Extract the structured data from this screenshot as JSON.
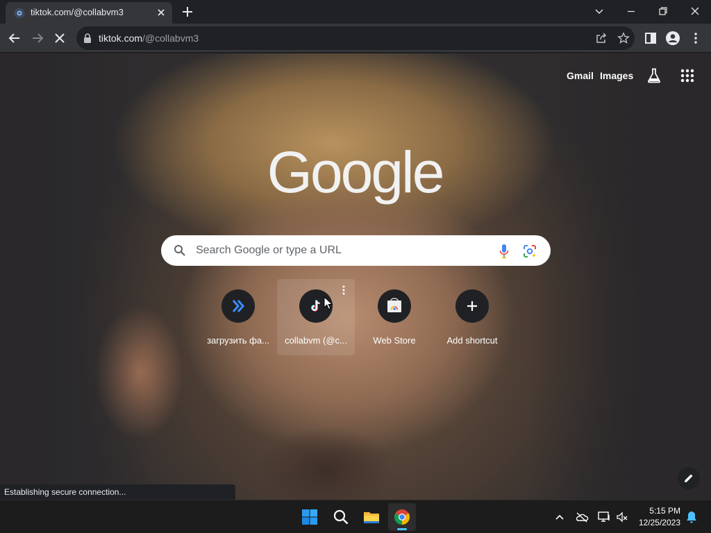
{
  "browser": {
    "tab": {
      "title": "tiktok.com/@collabvm3",
      "favicon": "tiktok-favicon-icon",
      "close": "close-icon"
    },
    "new_tab": "plus-icon",
    "window_controls": [
      "chevron-down-icon",
      "minimize-icon",
      "restore-icon",
      "close-icon"
    ]
  },
  "toolbar": {
    "buttons": [
      "back-arrow-icon",
      "forward-arrow-icon",
      "stop-loading-icon"
    ],
    "url_host": "tiktok.com",
    "url_path": "/@collabvm3",
    "omnibox_icons": [
      "share-icon",
      "star-icon"
    ],
    "right_icons": [
      "side-panel-icon",
      "profile-icon",
      "menu-dots-icon"
    ]
  },
  "ntp": {
    "top_links": {
      "gmail": "Gmail",
      "images": "Images"
    },
    "logo": "Google",
    "search": {
      "placeholder": "Search Google or type a URL"
    },
    "shortcuts": [
      {
        "label": "загрузить фа...",
        "icon": "double-chevron-icon",
        "hovered": false
      },
      {
        "label": "collabvm (@c...",
        "icon": "tiktok-icon",
        "hovered": true
      },
      {
        "label": "Web Store",
        "icon": "webstore-icon",
        "hovered": false
      },
      {
        "label": "Add shortcut",
        "icon": "plus-icon",
        "hovered": false
      }
    ],
    "customize": "pencil-icon"
  },
  "status_bubble": "Establishing secure connection...",
  "taskbar": {
    "apps": [
      "windows-start-icon",
      "search-icon",
      "file-explorer-icon",
      "chrome-icon"
    ],
    "tray": [
      "chevron-up-icon",
      "onedrive-offline-icon",
      "network-icon",
      "volume-muted-icon"
    ],
    "time": "5:15 PM",
    "date": "12/25/2023",
    "notification": "bell-icon"
  },
  "colors": {
    "accent": "#4cc2ff",
    "chrome_dark": "#202124",
    "toolbar": "#35363a"
  }
}
